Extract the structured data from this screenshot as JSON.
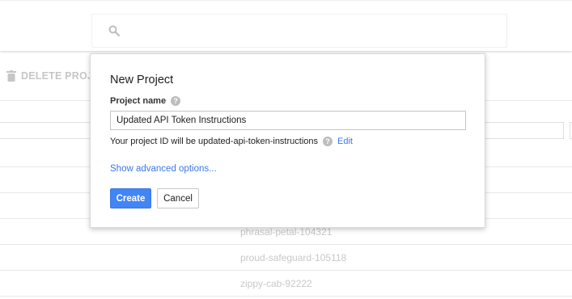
{
  "background": {
    "toolbar": {
      "delete_label": "DELETE PROJ"
    },
    "projects": [
      "phrasal-petal-104321",
      "proud-safeguard-105118",
      "zippy-cab-92222"
    ]
  },
  "dialog": {
    "title": "New Project",
    "project_name_label": "Project name",
    "project_name_value": "Updated API Token Instructions",
    "project_id_text": "Your project ID will be updated-api-token-instructions",
    "edit_label": "Edit",
    "help_glyph": "?",
    "advanced_label": "Show advanced options...",
    "create_label": "Create",
    "cancel_label": "Cancel"
  },
  "colors": {
    "accent": "#4285f4",
    "link": "#3b78e7"
  }
}
